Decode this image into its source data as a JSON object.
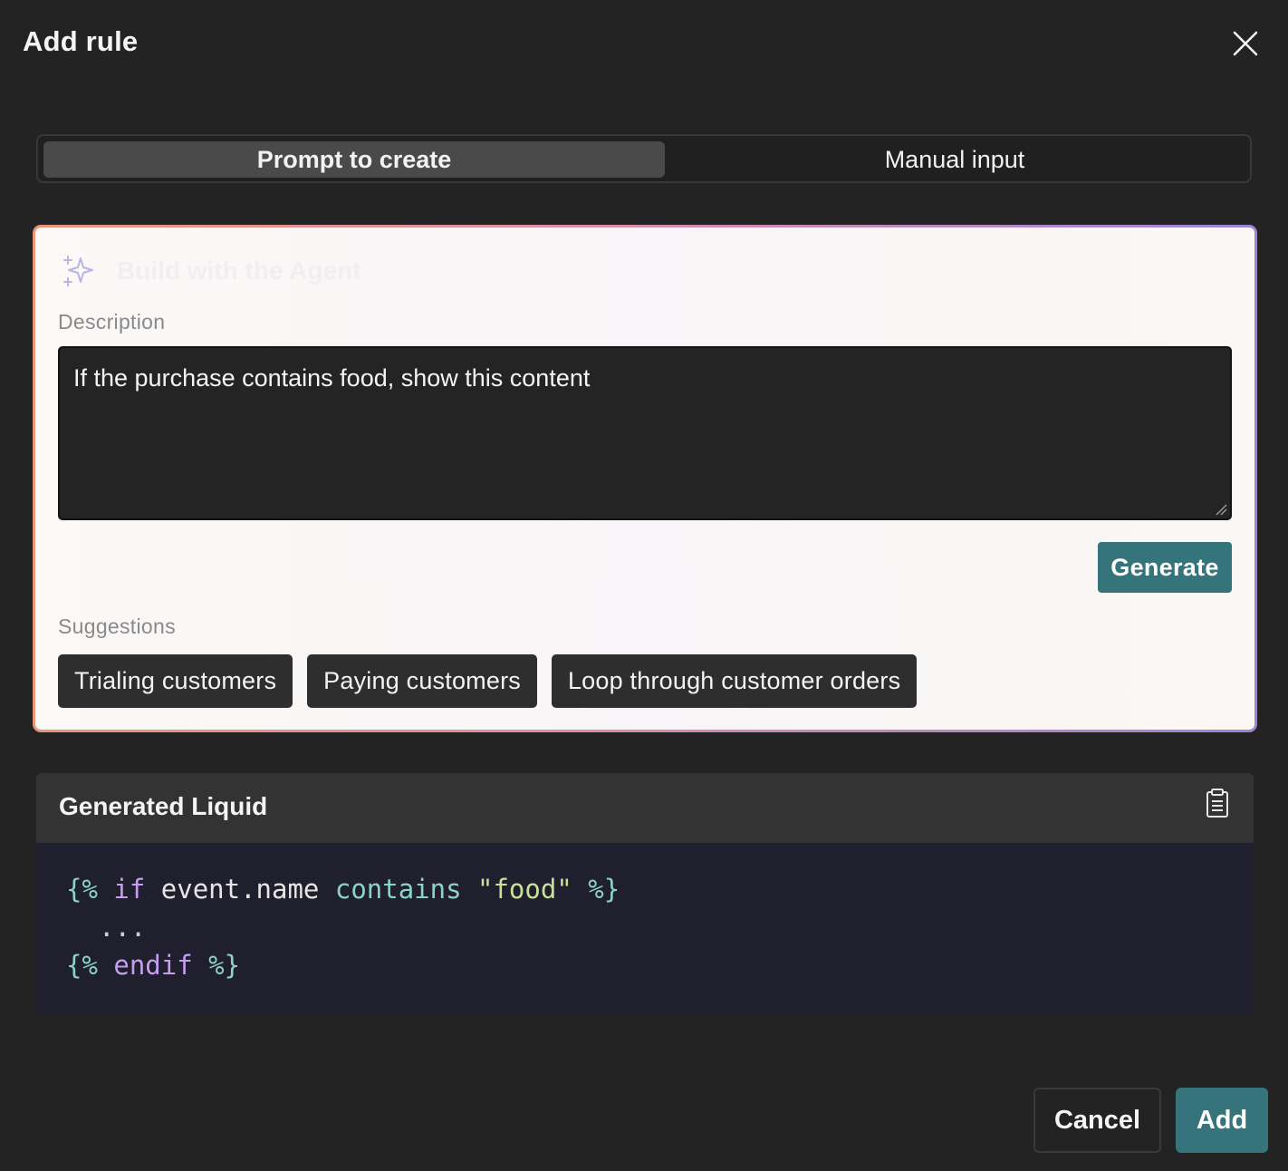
{
  "dialog": {
    "title": "Add rule",
    "close_icon": "close-icon"
  },
  "tabs": [
    {
      "label": "Prompt to create",
      "active": true
    },
    {
      "label": "Manual input",
      "active": false
    }
  ],
  "agent": {
    "icon": "sparkle-icon",
    "title": "Build with the Agent",
    "description_label": "Description",
    "description_value": "If the purchase contains food, show this content",
    "generate_label": "Generate",
    "suggestions_label": "Suggestions",
    "suggestions": [
      "Trialing customers",
      "Paying customers",
      "Loop through customer orders"
    ]
  },
  "generated": {
    "title": "Generated Liquid",
    "copy_icon": "clipboard-icon",
    "code": {
      "line1": {
        "open": "{%",
        "kw": "if",
        "var": "event.name",
        "op": "contains",
        "str": "\"food\"",
        "close": "%}"
      },
      "line2": "...",
      "line3": {
        "open": "{%",
        "kw": "endif",
        "close": "%}"
      }
    }
  },
  "footer": {
    "cancel_label": "Cancel",
    "add_label": "Add"
  },
  "colors": {
    "accent": "#36747c",
    "background": "#232323",
    "gradient_start": "#e9957b",
    "gradient_end": "#9a86d8"
  }
}
